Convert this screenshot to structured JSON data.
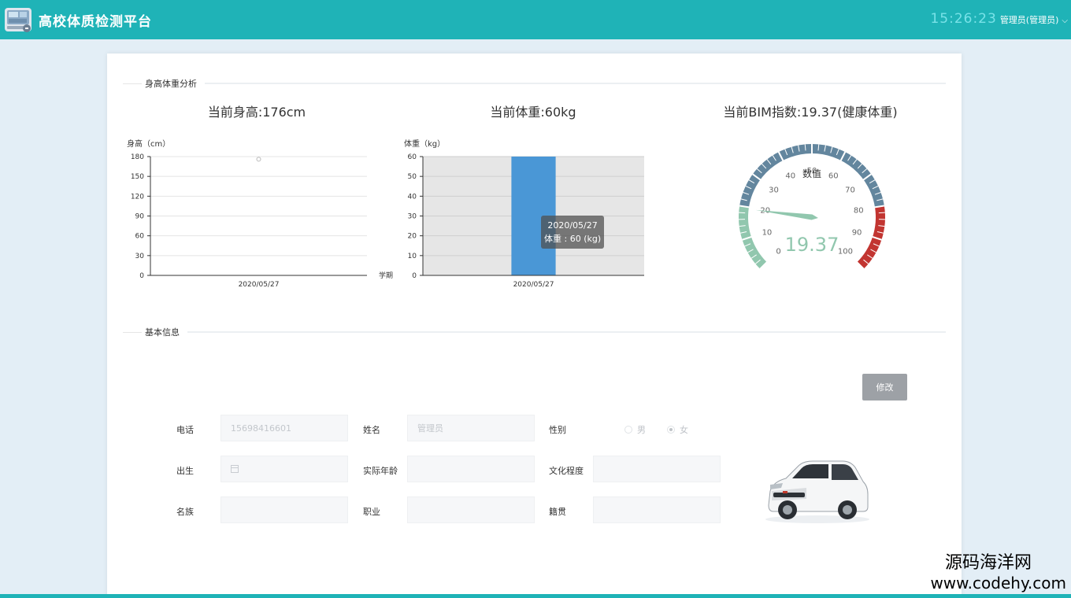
{
  "header": {
    "app_title": "高校体质检测平台",
    "clock": "15:26:23",
    "user": "管理员(管理员)",
    "logo_icon": "monitor-logo-icon"
  },
  "section_analysis": {
    "title": "身高体重分析"
  },
  "headlines": {
    "height": "当前身高:176cm",
    "weight": "当前体重:60kg",
    "bmi": "当前BIM指数:19.37(健康体重)"
  },
  "chart_data": [
    {
      "type": "scatter",
      "ylabel": "身高（cm）",
      "xlabel": "学期",
      "categories": [
        "2020/05/27"
      ],
      "values": [
        176
      ],
      "ylim": [
        0,
        180
      ],
      "yticks": [
        "0",
        "30",
        "60",
        "90",
        "120",
        "150",
        "180"
      ],
      "grid": true
    },
    {
      "type": "bar",
      "ylabel": "体重（kg）",
      "categories": [
        "2020/05/27"
      ],
      "values": [
        60
      ],
      "ylim": [
        0,
        60
      ],
      "yticks": [
        "0",
        "10",
        "20",
        "30",
        "40",
        "50",
        "60"
      ],
      "grid": true,
      "bar_color": "#4a97d6",
      "tooltip": {
        "title": "2020/05/27",
        "text": "体重 : 60 (kg)"
      }
    },
    {
      "type": "gauge",
      "label": "数值",
      "value": 19.37,
      "display_value": "19.37",
      "min": 0,
      "max": 100,
      "ticks": [
        "0",
        "10",
        "20",
        "30",
        "40",
        "50",
        "60",
        "70",
        "80",
        "90",
        "100"
      ],
      "color_bands": [
        {
          "to": 20,
          "color": "#91c7ae"
        },
        {
          "to": 80,
          "color": "#63869e"
        },
        {
          "to": 100,
          "color": "#c23531"
        }
      ]
    }
  ],
  "section_info": {
    "title": "基本信息"
  },
  "edit_button": "修改",
  "form": {
    "phone_label": "电话",
    "phone_value": "15698416601",
    "name_label": "姓名",
    "name_value": "管理员",
    "gender_label": "性别",
    "gender_male": "男",
    "gender_female": "女",
    "birth_label": "出生",
    "birth_icon": "calendar-icon",
    "age_label": "实际年龄",
    "education_label": "文化程度",
    "ethnicity_label": "名族",
    "job_label": "职业",
    "origin_label": "籍贯"
  },
  "watermark": {
    "line1": "源码海洋网",
    "line2": "www.codehy.com"
  },
  "colors": {
    "accent": "#1fb3b7",
    "clock": "#79e2e8",
    "button": "#9da1a6"
  }
}
